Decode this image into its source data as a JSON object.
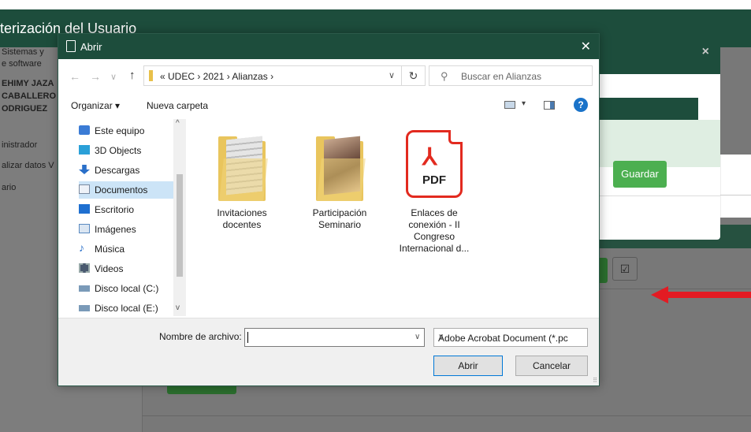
{
  "background_page": {
    "header_title": "terización del Usuario",
    "sidebar_lines": [
      "Sistemas y ",
      "e software",
      "EHIMY JAZA",
      "CABALLERO",
      "ODRIGUEZ",
      "inistrador",
      "alizar datos V",
      "ario"
    ],
    "modal_save_label": "Guardar",
    "modal_close": "×",
    "edit_icon": "☑"
  },
  "dialog": {
    "title": "Abrir",
    "close": "✕",
    "nav": {
      "back": "←",
      "forward": "→",
      "recent": "∨",
      "up": "↑",
      "breadcrumb": "«  UDEC  ›  2021  ›  Alianzas  ›",
      "address_dropdown": "∨",
      "refresh": "↻",
      "search_placeholder": "Buscar en Alianzas"
    },
    "toolbar": {
      "organize": "Organizar ▾",
      "new_folder": "Nueva carpeta",
      "view_dropdown": "▾",
      "help": "?"
    },
    "nav_pane": [
      {
        "label": "Este equipo",
        "icon": "computer-icon",
        "color": "#3a7bd5"
      },
      {
        "label": "3D Objects",
        "icon": "cube-icon",
        "color": "#2aa0d8"
      },
      {
        "label": "Descargas",
        "icon": "download-icon",
        "color": "#2a6fc9"
      },
      {
        "label": "Documentos",
        "icon": "document-icon",
        "color": "#7a8aa0",
        "selected": true
      },
      {
        "label": "Escritorio",
        "icon": "desktop-icon",
        "color": "#1e6fd0"
      },
      {
        "label": "Imágenes",
        "icon": "pictures-icon",
        "color": "#5a8ac0"
      },
      {
        "label": "Música",
        "icon": "music-icon",
        "color": "#2a6fc9"
      },
      {
        "label": "Videos",
        "icon": "video-icon",
        "color": "#4a5a70"
      },
      {
        "label": "Disco local (C:)",
        "icon": "drive-icon",
        "color": "#7a9ab8"
      },
      {
        "label": "Disco local (E:)",
        "icon": "drive-icon",
        "color": "#7a9ab8"
      }
    ],
    "files": [
      {
        "name": "Invitaciones docentes",
        "kind": "folder"
      },
      {
        "name": "Participación Seminario",
        "kind": "folder"
      },
      {
        "name": "Enlaces de conexión - II Congreso Internacional d...",
        "kind": "pdf",
        "badge": "PDF"
      }
    ],
    "footer": {
      "filename_label": "Nombre de archivo:",
      "filename_value": "",
      "filename_dropdown": "∨",
      "filetype": "Adobe Acrobat Document (*.pc",
      "filetype_dropdown": "∨",
      "open": "Abrir",
      "cancel": "Cancelar"
    }
  },
  "colors": {
    "header_green": "#1d4d3c",
    "save_green": "#4caf50",
    "arrow_red": "#e31b23",
    "pdf_red": "#e22a1f",
    "selection_blue": "#cce4f7"
  }
}
